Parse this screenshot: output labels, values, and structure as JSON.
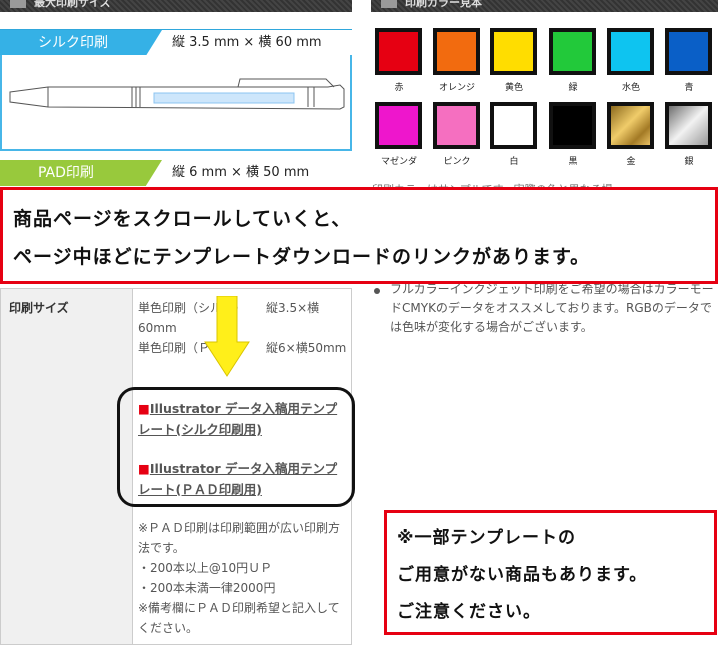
{
  "header": {
    "left_title": "最大印刷サイズ",
    "right_title": "印刷カラー見本"
  },
  "methods": {
    "silk": {
      "label": "シルク印刷",
      "size": "縦 3.5 mm × 横 60 mm"
    },
    "pad": {
      "label": "PAD印刷",
      "size": "縦 6 mm × 横 50 mm"
    }
  },
  "colors": [
    {
      "name": "赤",
      "hex": "#e60012"
    },
    {
      "name": "オレンジ",
      "hex": "#f26b0f"
    },
    {
      "name": "黄色",
      "hex": "#ffdd00"
    },
    {
      "name": "緑",
      "hex": "#22c93a"
    },
    {
      "name": "水色",
      "hex": "#0ec4f0"
    },
    {
      "name": "青",
      "hex": "#0a5fc7"
    },
    {
      "name": "マゼンダ",
      "hex": "#ee16cc"
    },
    {
      "name": "ピンク",
      "hex": "#f56fc0"
    },
    {
      "name": "白",
      "hex": "#ffffff"
    },
    {
      "name": "黒",
      "hex": "#000000"
    },
    {
      "name": "金",
      "hex": "#c89b35"
    },
    {
      "name": "銀",
      "hex": "#a8a8a8"
    }
  ],
  "print_notes": {
    "partial_line": "印刷カラーはサンプルです。実際の色と異なる場",
    "fullcolor": "フルカラーインクジェット印刷をご希望の場合はカラーモードCMYKのデータをオススメしております。RGBのデータでは色味が変化する場合がございます。"
  },
  "table": {
    "header": "印刷サイズ",
    "row1_label": "単色印刷（シルク）",
    "row1_value": "縦3.5×横60mm",
    "row2_label": "単色印刷（ＰＡＤ）",
    "row2_value": "縦6×横50mm",
    "link_silk": "Illustrator データ入稿用テンプレート(シルク印刷用)",
    "link_pad": "Illustrator データ入稿用テンプレート(ＰＡＤ印刷用)",
    "note1": "※ＰＡＤ印刷は印刷範囲が広い印刷方法です。",
    "note2": "・200本以上@10円ＵＰ",
    "note3": "・200本未満一律2000円",
    "note4": "※備考欄にＰＡＤ印刷希望と記入してください。"
  },
  "callout_top": {
    "line1": "商品ページをスクロールしていくと、",
    "line2": "ページ中ほどにテンプレートダウンロードのリンクがあります。"
  },
  "callout_bottom": {
    "line1": "※一部テンプレートの",
    "line2": "ご用意がない商品もあります。",
    "line3": "ご注意ください。"
  },
  "link_marker": "■"
}
